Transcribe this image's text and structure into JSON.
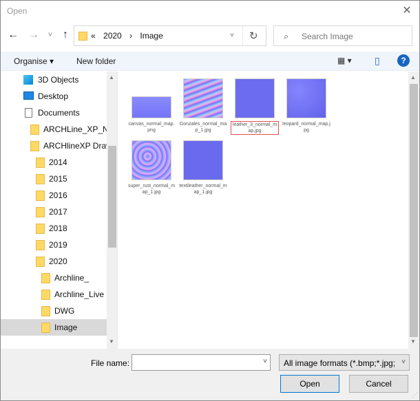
{
  "window": {
    "title": "Open",
    "close_glyph": "✕"
  },
  "nav": {
    "back": "←",
    "forward": "→",
    "recent": "˅",
    "up": "↑",
    "breadcrumbs": [
      "«",
      "2020",
      "›",
      "Image"
    ],
    "chevron": "˅",
    "refresh": "↻",
    "search_placeholder": "Search Image"
  },
  "toolbar": {
    "organise": "Organise ▾",
    "new_folder": "New folder",
    "view_icon": "▦ ▾",
    "pane_icon": "▯",
    "help": "?"
  },
  "tree": [
    {
      "label": "3D Objects",
      "icon": "3d-objects-icon"
    },
    {
      "label": "Desktop",
      "icon": "desktop-icon"
    },
    {
      "label": "Documents",
      "icon": "documents-icon"
    },
    {
      "label": "ARCHLine_XP_Na",
      "icon": "folder-icon"
    },
    {
      "label": "ARCHlineXP Draw",
      "icon": "folder-icon"
    },
    {
      "label": "2014",
      "icon": "folder-icon"
    },
    {
      "label": "2015",
      "icon": "folder-icon"
    },
    {
      "label": "2016",
      "icon": "folder-icon"
    },
    {
      "label": "2017",
      "icon": "folder-icon"
    },
    {
      "label": "2018",
      "icon": "folder-icon"
    },
    {
      "label": "2019",
      "icon": "folder-icon"
    },
    {
      "label": "2020",
      "icon": "folder-icon"
    },
    {
      "label": "Archline_",
      "icon": "folder-icon"
    },
    {
      "label": "Archline_Live",
      "icon": "folder-icon"
    },
    {
      "label": "DWG",
      "icon": "folder-icon"
    },
    {
      "label": "Image",
      "icon": "folder-icon"
    }
  ],
  "files": [
    {
      "name": "canvas_normal_map.png"
    },
    {
      "name": "Gonzales_normal_map_1.jpg"
    },
    {
      "name": "leather_3_normal_map.jpg"
    },
    {
      "name": "leopard_normal_map.jpg"
    },
    {
      "name": "super_rust_normal_map_1.jpg"
    },
    {
      "name": "textileather_normal_map_1.jpg"
    }
  ],
  "bottom": {
    "file_name_label": "File name:",
    "file_name_value": "",
    "filter": "All image formats (*.bmp;*.jpg;",
    "open": "Open",
    "cancel": "Cancel"
  },
  "colors": {
    "accent": "#0078d7",
    "selected": "#d9d9d9",
    "toolbar_bg": "#f0f5fb",
    "normal_map": "#7f7fff",
    "highlight_outline": "#e05050"
  }
}
